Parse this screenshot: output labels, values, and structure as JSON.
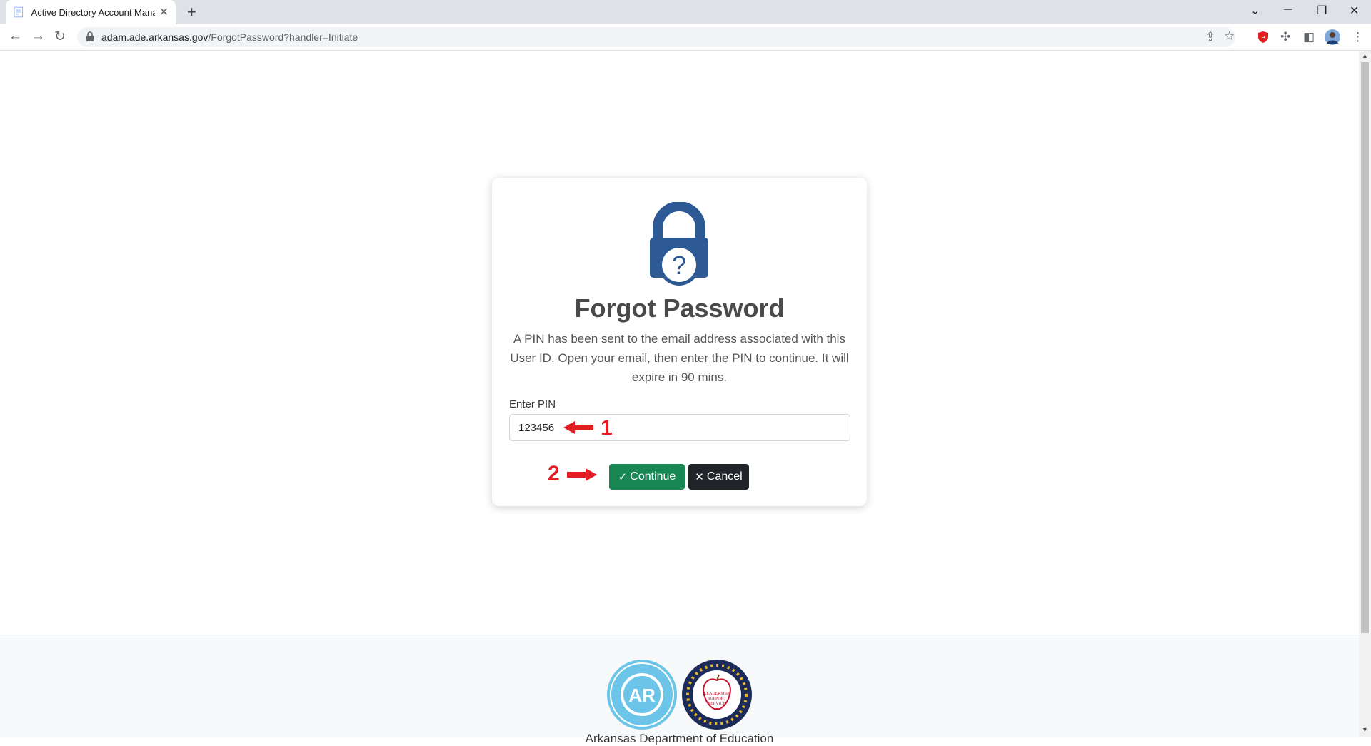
{
  "browser": {
    "tab_title": "Active Directory Account Manag",
    "url_domain": "adam.ade.arkansas.gov",
    "url_path": "/ForgotPassword?handler=Initiate",
    "new_tab_icon": "plus-icon"
  },
  "card": {
    "title": "Forgot Password",
    "description": "A PIN has been sent to the email address associated with this User ID. Open your email, then enter the PIN to continue. It will expire in 90 mins.",
    "pin_label": "Enter PIN",
    "pin_value": "123456",
    "continue_label": "Continue",
    "cancel_label": "Cancel"
  },
  "annotations": {
    "step1": "1",
    "step2": "2"
  },
  "footer": {
    "text": "Arkansas Department of Education"
  },
  "colors": {
    "continue": "#198754",
    "cancel": "#212529",
    "lock": "#2d5a95",
    "annotation": "#e31b23"
  }
}
